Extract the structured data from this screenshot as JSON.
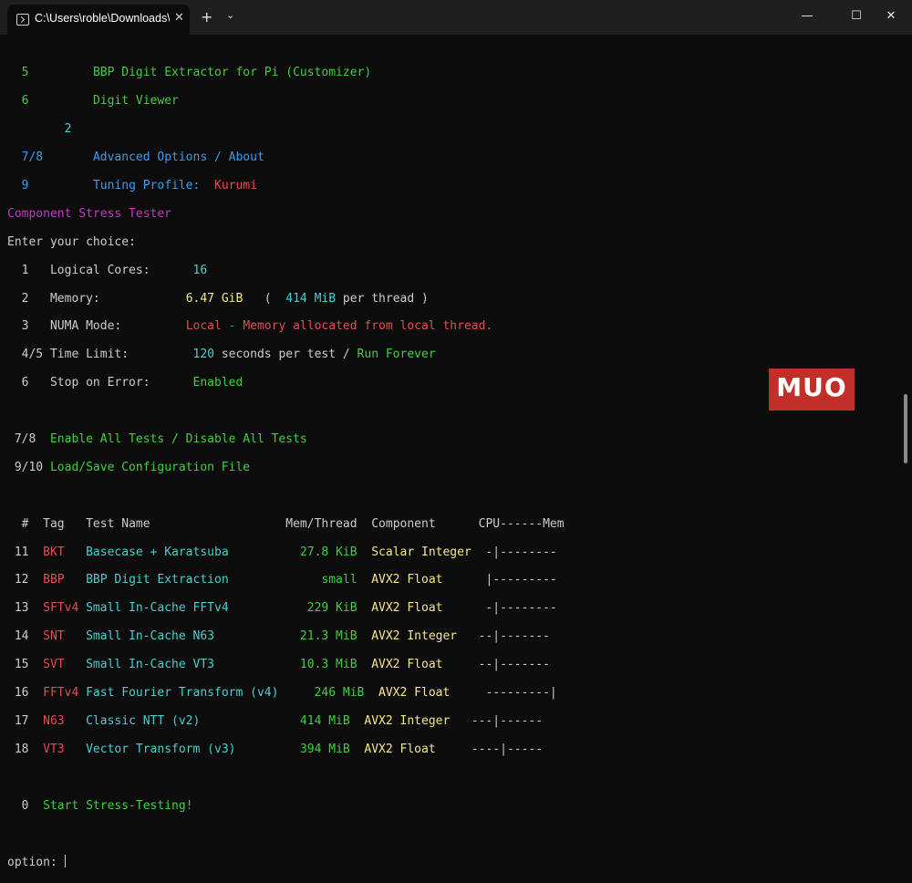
{
  "window": {
    "tab_title": "C:\\Users\\roble\\Downloads\\y-c",
    "tab_close": "✕",
    "new_tab": "+",
    "dropdown": "⌄",
    "minimize": "—",
    "maximize": "☐",
    "close": "✕"
  },
  "menu_top": [
    {
      "num": "5",
      "label": "BBP Digit Extractor for Pi (Customizer)"
    },
    {
      "num": "6",
      "label": "Digit Viewer"
    }
  ],
  "stray": "2",
  "menu_adv": {
    "num": "7/8",
    "label": "Advanced Options / About"
  },
  "menu_tuning": {
    "num": "9",
    "label": "Tuning Profile:",
    "value": "Kurumi"
  },
  "section_title": "Component Stress Tester",
  "prompt_choice": "Enter your choice:",
  "settings": {
    "cores": {
      "num": "1",
      "label": "Logical Cores:",
      "value": "16"
    },
    "memory": {
      "num": "2",
      "label": "Memory:",
      "value": "6.47 GiB",
      "open": "(",
      "per": "414 MiB",
      "per_text": "per thread",
      "close": ")"
    },
    "numa": {
      "num": "3",
      "label": "NUMA Mode:",
      "value": "Local - Memory allocated from local thread."
    },
    "time": {
      "num": "4/5",
      "label": "Time Limit:",
      "seconds": "120",
      "text": "seconds per test /",
      "forever": "Run Forever"
    },
    "stop": {
      "num": "6",
      "label": "Stop on Error:",
      "value": "Enabled"
    }
  },
  "options": [
    {
      "num": "7/8",
      "label": "Enable All Tests / Disable All Tests"
    },
    {
      "num": "9/10",
      "label": "Load/Save Configuration File"
    }
  ],
  "table": {
    "headers": {
      "num": "#",
      "tag": "Tag",
      "name": "Test Name",
      "mem": "Mem/Thread",
      "component": "Component",
      "cpu": "CPU------Mem"
    },
    "rows": [
      {
        "num": "11",
        "tag": "BKT",
        "name": "Basecase + Karatsuba",
        "mem": "27.8 KiB",
        "component": "Scalar Integer",
        "bar": "-|--------"
      },
      {
        "num": "12",
        "tag": "BBP",
        "name": "BBP Digit Extraction",
        "mem": "small",
        "component": "AVX2 Float",
        "bar": "|---------"
      },
      {
        "num": "13",
        "tag": "SFTv4",
        "name": "Small In-Cache FFTv4",
        "mem": "229 KiB",
        "component": "AVX2 Float",
        "bar": "-|--------"
      },
      {
        "num": "14",
        "tag": "SNT",
        "name": "Small In-Cache N63",
        "mem": "21.3 MiB",
        "component": "AVX2 Integer",
        "bar": "--|-------"
      },
      {
        "num": "15",
        "tag": "SVT",
        "name": "Small In-Cache VT3",
        "mem": "10.3 MiB",
        "component": "AVX2 Float",
        "bar": "--|-------"
      },
      {
        "num": "16",
        "tag": "FFTv4",
        "name": "Fast Fourier Transform (v4)",
        "mem": "246 MiB",
        "component": "AVX2 Float",
        "bar": "---------|"
      },
      {
        "num": "17",
        "tag": "N63",
        "name": "Classic NTT (v2)",
        "mem": "414 MiB",
        "component": "AVX2 Integer",
        "bar": "---|------"
      },
      {
        "num": "18",
        "tag": "VT3",
        "name": "Vector Transform (v3)",
        "mem": "394 MiB",
        "component": "AVX2 Float",
        "bar": "----|-----"
      }
    ]
  },
  "start": {
    "num": "0",
    "label": "Start Stress-Testing!"
  },
  "option_prompt": "option:",
  "watermark": "MUO",
  "colors": {
    "background": "#0c0c0c",
    "green": "#3fcf3f",
    "blue": "#3b9cf0",
    "cyan": "#46d0d0",
    "red": "#e04c56",
    "yellow": "#f5e88a",
    "magenta": "#c836c8",
    "watermark": "#d6332c"
  }
}
